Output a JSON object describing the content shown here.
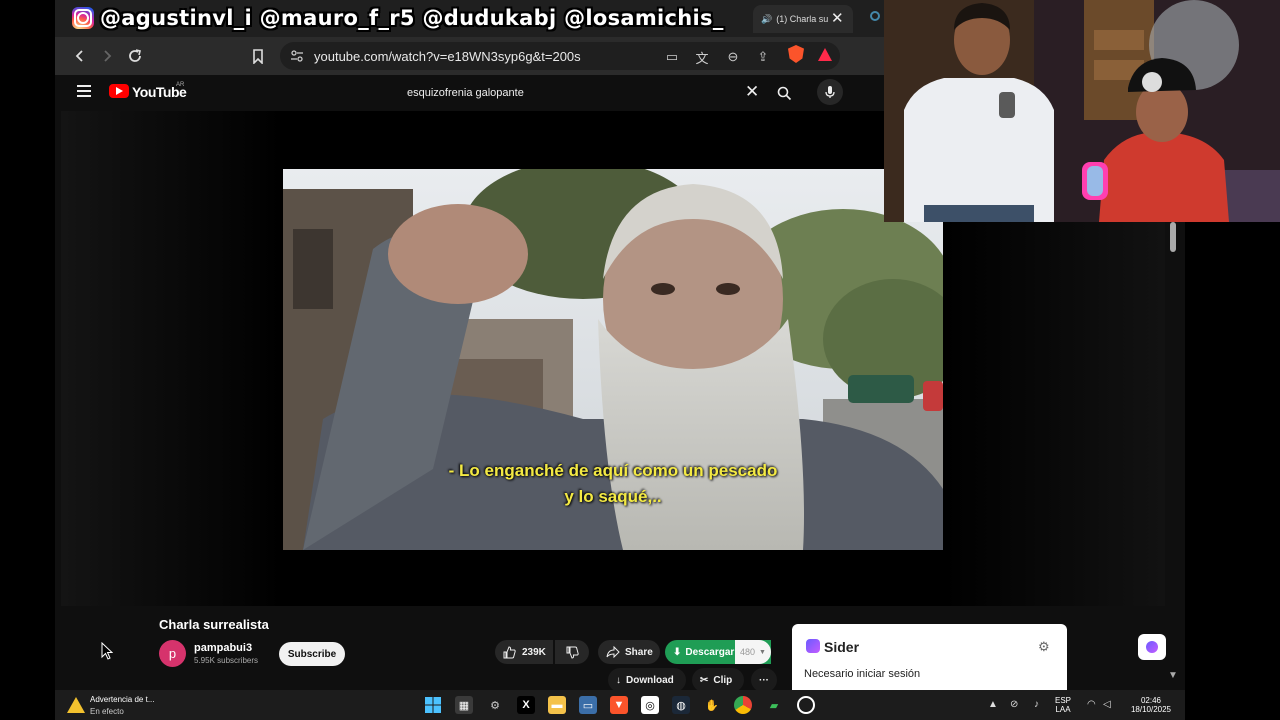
{
  "overlay": {
    "handles": "@agustinvl_i @mauro_f_r5 @dudukabj @losamichis_"
  },
  "browser": {
    "active_tab_title": "(1) Charla su",
    "tab_close": "✕",
    "url": "youtube.com/watch?v=e18WN3syp6g&t=200s",
    "extension_badge": "20"
  },
  "youtube": {
    "logo_text": "YouTube",
    "country_code": "AR",
    "search_query": "esquizofrenia galopante"
  },
  "video": {
    "subtitle_line1": "- Lo enganché de aquí como un pescado",
    "subtitle_line2": "y lo saqué,..",
    "title": "Charla surrealista",
    "channel_initial": "p",
    "channel_name": "pampabui3",
    "subscribers": "5.95K subscribers",
    "subscribe_label": "Subscribe",
    "like_count": "239K",
    "share_label": "Share",
    "descargar_label": "Descargar",
    "descargar_count": "480",
    "download_label": "Download",
    "clip_label": "Clip",
    "more_label": "···"
  },
  "sider": {
    "title": "Sider",
    "message": "Necesario iniciar sesión"
  },
  "taskbar": {
    "notification_title": "Advertencia de t...",
    "notification_sub": "En efecto",
    "lang_line1": "ESP",
    "lang_line2": "LAA",
    "time": "02:46",
    "date": "18/10/2025"
  },
  "colors": {
    "youtube_red": "#ff0000",
    "download_green": "#1f9d55",
    "subtitle_yellow": "#f4ea44",
    "brave_orange": "#fb542b"
  }
}
